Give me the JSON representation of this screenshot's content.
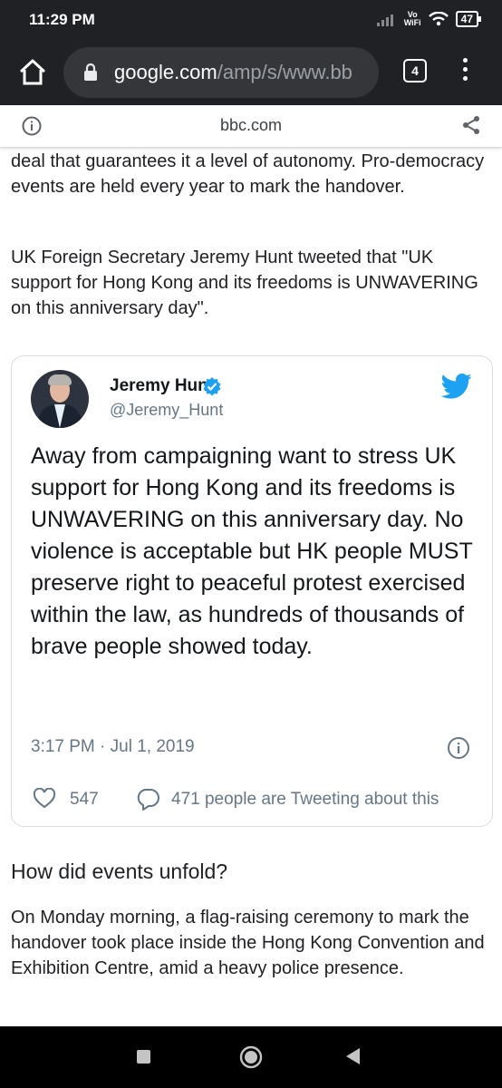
{
  "status_bar": {
    "time": "11:29 PM",
    "vowifi_top": "Vo",
    "vowifi_bottom": "WiFi",
    "battery": "47"
  },
  "browser": {
    "url_host": "google.com",
    "url_path": "/amp/s/www.bb",
    "tab_count": "4"
  },
  "amp_header": {
    "domain": "bbc.com"
  },
  "article": {
    "paragraph_top": "deal that guarantees it a level of autonomy. Pro-democracy events are held every year to mark the handover.",
    "paragraph_hunt": "UK Foreign Secretary Jeremy Hunt tweeted that \"UK support for Hong Kong and its freedoms is UNWAVERING on this anniversary day\".",
    "heading": "How did events unfold?",
    "paragraph_bottom": "On Monday morning, a flag-raising ceremony to mark the handover took place inside the Hong Kong Convention and Exhibition Centre, amid a heavy police presence."
  },
  "tweet": {
    "author_name": "Jeremy Hunt",
    "author_handle": "@Jeremy_Hunt",
    "text": "Away from campaigning want to stress UK support for Hong Kong and its freedoms is UNWAVERING on this anniversary day. No violence is acceptable but HK people MUST preserve right to  peaceful protest exercised within the law, as hundreds of thousands of brave people showed today.",
    "timestamp": "3:17 PM · Jul 1, 2019",
    "likes": "547",
    "tweeting": "471 people are Tweeting about this"
  },
  "colors": {
    "twitter_blue": "#1da1f2",
    "chrome_dark": "#202124",
    "omnibox": "#35363a"
  },
  "icons": [
    "home-icon",
    "lock-icon",
    "tabs-icon",
    "menu-icon",
    "info-icon",
    "share-icon",
    "verified-icon",
    "twitter-logo-icon",
    "heart-icon",
    "reply-icon",
    "nav-recents-icon",
    "nav-home-icon",
    "nav-back-icon"
  ]
}
